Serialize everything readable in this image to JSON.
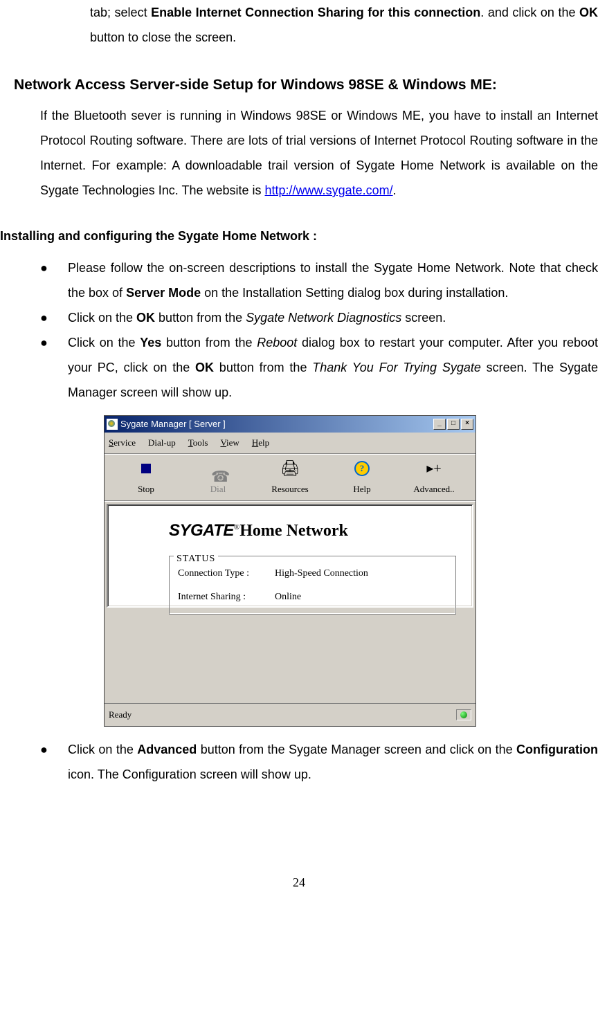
{
  "page": {
    "partial_top_1": "tab; select ",
    "partial_top_bold": "Enable Internet Connection Sharing for this connection",
    "partial_top_2": ". and click on the ",
    "partial_top_bold2": "OK",
    "partial_top_3": " button to close the screen.",
    "heading1": "Network Access Server-side Setup for Windows 98SE & Windows ME:",
    "para1_a": "If the Bluetooth sever is running in Windows 98SE or Windows ME, you have to install an Internet Protocol Routing software. There are lots of trial versions of Internet Protocol Routing software in the Internet. For example: A downloadable trail version of Sygate Home Network is available on the Sygate Technologies Inc. The website is ",
    "para1_link": "http://www.sygate.com/",
    "para1_b": ".",
    "subheading": "Installing and configuring the Sygate Home Network :",
    "bullets": [
      {
        "pre": "Please follow the on-screen descriptions to install the Sygate Home Network. Note that check the box of ",
        "b1": "Server Mode",
        "mid": " on the Installation Setting dialog box during installation.",
        "segments": [
          "pre",
          "b1",
          "mid"
        ]
      },
      {
        "pre": "Click on the ",
        "b1": "OK",
        "mid": " button from the ",
        "i1": "Sygate Network Diagnostics",
        "post": " screen."
      },
      {
        "pre": "Click on the ",
        "b1": "Yes",
        "mid": " button from the ",
        "i1": "Reboot",
        "mid2": " dialog box to restart your computer. After you reboot your PC, click on the ",
        "b2": "OK",
        "mid3": " button from the ",
        "i2": "Thank You For Trying Sygate",
        "post": " screen. The Sygate Manager screen will show up."
      },
      {
        "pre": "Click on the ",
        "b1": "Advanced",
        "mid": " button from the Sygate Manager screen and click on the ",
        "b2": "Configuration",
        "post": " icon. The Configuration screen will show up."
      }
    ],
    "page_number": "24"
  },
  "sygate": {
    "title": "Sygate Manager  [ Server ]",
    "menu": {
      "service": "Service",
      "service_u": "S",
      "dialup": "Dial-up",
      "tools": "Tools",
      "tools_u": "T",
      "view": "View",
      "view_u": "V",
      "help": "Help",
      "help_u": "H"
    },
    "toolbar": {
      "stop": "Stop",
      "dial": "Dial",
      "resources": "Resources",
      "help": "Help",
      "advanced": "Advanced.."
    },
    "logo_brand": "SYGATE",
    "logo_rest": "Home Network",
    "status": {
      "title": "STATUS",
      "conn_label": "Connection Type :",
      "conn_value": "High-Speed Connection",
      "share_label": "Internet Sharing :",
      "share_value": "Online"
    },
    "ready": "Ready"
  }
}
